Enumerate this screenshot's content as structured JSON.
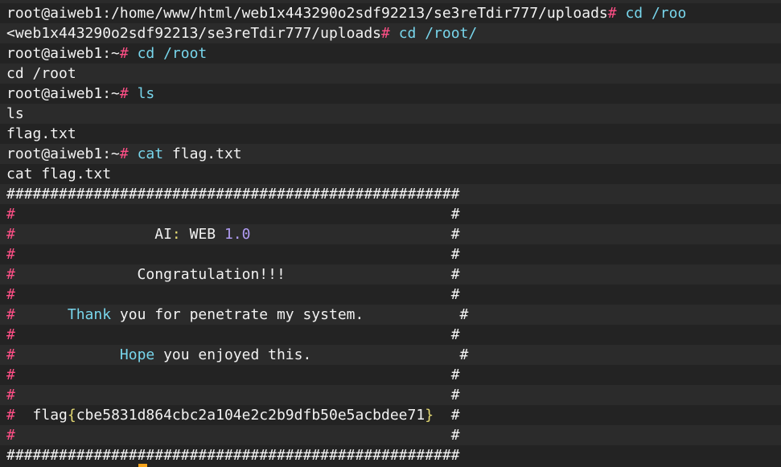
{
  "colors": {
    "background": "#232323",
    "text": "#f2f2f2",
    "prompt_symbol": "#ff4f86",
    "command": "#78d6ec",
    "cursor": "#f5a31a"
  },
  "terminal": {
    "lines": [
      [
        {
          "t": "root@aiweb1:/home/www/html/web1x443290o2sdf92213/se3reTdir777/uploads",
          "c": "w"
        },
        {
          "t": "# ",
          "c": "p"
        },
        {
          "t": "cd /roo",
          "c": "c"
        }
      ],
      [
        {
          "t": "<web1x443290o2sdf92213/se3reTdir777/uploads",
          "c": "w"
        },
        {
          "t": "# ",
          "c": "p"
        },
        {
          "t": "cd /root/",
          "c": "c"
        }
      ],
      [
        {
          "t": "root@aiweb1:~",
          "c": "w"
        },
        {
          "t": "# ",
          "c": "p"
        },
        {
          "t": "cd /root",
          "c": "c"
        }
      ],
      [
        {
          "t": "cd /root",
          "c": "w"
        }
      ],
      [
        {
          "t": "root@aiweb1:~",
          "c": "w"
        },
        {
          "t": "# ",
          "c": "p"
        },
        {
          "t": "ls",
          "c": "c"
        }
      ],
      [
        {
          "t": "ls",
          "c": "w"
        }
      ],
      [
        {
          "t": "flag.txt",
          "c": "w"
        }
      ],
      [
        {
          "t": "root@aiweb1:~",
          "c": "w"
        },
        {
          "t": "# ",
          "c": "p"
        },
        {
          "t": "cat",
          "c": "c"
        },
        {
          "t": " flag.txt",
          "c": "w"
        }
      ],
      [
        {
          "t": "cat flag.txt",
          "c": "w"
        }
      ],
      [
        {
          "t": "####################################################",
          "c": "w"
        }
      ],
      [
        {
          "t": "#",
          "c": "p"
        },
        {
          "t": "                                                  #",
          "c": "w"
        }
      ],
      [
        {
          "t": "#",
          "c": "p"
        },
        {
          "t": "                ",
          "c": "w"
        },
        {
          "t": "AI",
          "c": "w"
        },
        {
          "t": ":",
          "c": "y"
        },
        {
          "t": " WEB ",
          "c": "w"
        },
        {
          "t": "1.0",
          "c": "v"
        },
        {
          "t": "                       #",
          "c": "w"
        }
      ],
      [
        {
          "t": "#",
          "c": "p"
        },
        {
          "t": "                                                  #",
          "c": "w"
        }
      ],
      [
        {
          "t": "#",
          "c": "p"
        },
        {
          "t": "              Congratulation!!!                   #",
          "c": "w"
        }
      ],
      [
        {
          "t": "#",
          "c": "p"
        },
        {
          "t": "                                                  #",
          "c": "w"
        }
      ],
      [
        {
          "t": "#",
          "c": "p"
        },
        {
          "t": "      ",
          "c": "w"
        },
        {
          "t": "Thank",
          "c": "c"
        },
        {
          "t": " you for penetrate my system.           #",
          "c": "w"
        }
      ],
      [
        {
          "t": "#",
          "c": "p"
        },
        {
          "t": "                                                  #",
          "c": "w"
        }
      ],
      [
        {
          "t": "#",
          "c": "p"
        },
        {
          "t": "            ",
          "c": "w"
        },
        {
          "t": "Hope",
          "c": "c"
        },
        {
          "t": " you enjoyed this.                 #",
          "c": "w"
        }
      ],
      [
        {
          "t": "#",
          "c": "p"
        },
        {
          "t": "                                                  #",
          "c": "w"
        }
      ],
      [
        {
          "t": "#",
          "c": "p"
        },
        {
          "t": "                                                  #",
          "c": "w"
        }
      ],
      [
        {
          "t": "#",
          "c": "p"
        },
        {
          "t": "  flag",
          "c": "w"
        },
        {
          "t": "{",
          "c": "y"
        },
        {
          "t": "cbe5831d864cbc2a104e2c2b9dfb50e5acbdee71",
          "c": "w"
        },
        {
          "t": "}",
          "c": "y"
        },
        {
          "t": "  #",
          "c": "w"
        }
      ],
      [
        {
          "t": "#",
          "c": "p"
        },
        {
          "t": "                                                  #",
          "c": "w"
        }
      ],
      [
        {
          "t": "####################################################",
          "c": "w"
        }
      ]
    ]
  }
}
